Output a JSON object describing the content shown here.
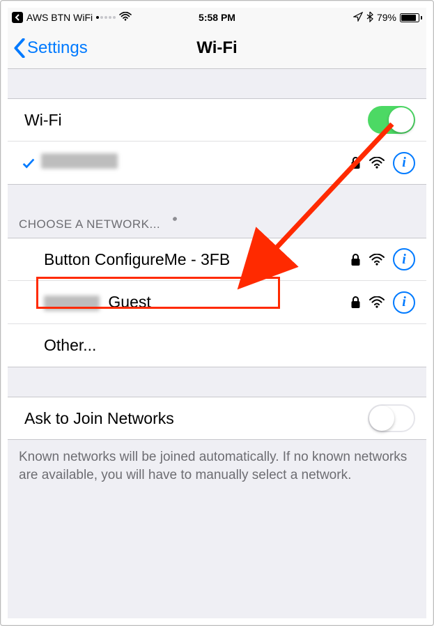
{
  "status_bar": {
    "back_app": "AWS BTN WiFi",
    "time": "5:58 PM",
    "battery_percent": "79%",
    "battery_level": 0.79
  },
  "nav": {
    "back_label": "Settings",
    "title": "Wi-Fi"
  },
  "wifi_section": {
    "wifi_label": "Wi-Fi",
    "wifi_on": true,
    "connected_network_name": "",
    "connected_blurred": true
  },
  "choose_header": "CHOOSE A NETWORK...",
  "networks": [
    {
      "name": "Button ConfigureMe - 3FB",
      "locked": true,
      "has_info": true,
      "blurred_prefix": false,
      "highlighted": true
    },
    {
      "name": "Guest",
      "locked": true,
      "has_info": true,
      "blurred_prefix": true
    },
    {
      "name": "Other...",
      "locked": false,
      "has_info": false,
      "blurred_prefix": false
    }
  ],
  "ask_join": {
    "label": "Ask to Join Networks",
    "on": false,
    "footer": "Known networks will be joined automatically. If no known networks are available, you will have to manually select a network."
  },
  "colors": {
    "tint": "#007aff",
    "green": "#4cd964",
    "arrow": "#ff2a00"
  }
}
